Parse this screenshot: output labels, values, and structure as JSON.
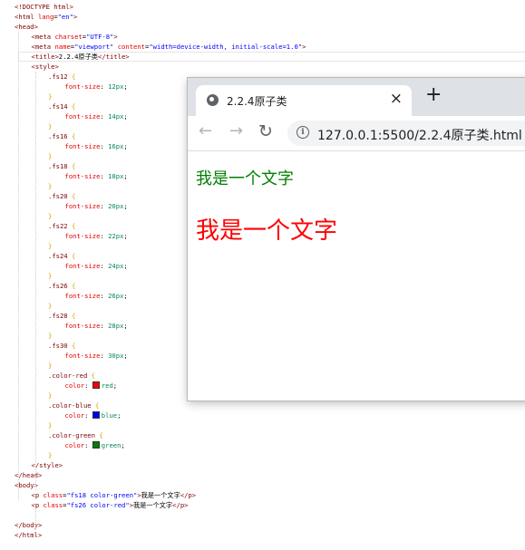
{
  "editor": {
    "lines": [
      {
        "indent": 0,
        "parts": [
          [
            "tag",
            "<!DOCTYPE html>"
          ]
        ]
      },
      {
        "indent": 0,
        "parts": [
          [
            "tag",
            "<html "
          ],
          [
            "attr",
            "lang"
          ],
          [
            "txt",
            "="
          ],
          [
            "str",
            "\"en\""
          ],
          [
            "tag",
            ">"
          ]
        ]
      },
      {
        "indent": 0,
        "parts": [
          [
            "tag",
            "<head>"
          ]
        ]
      },
      {
        "indent": 1,
        "parts": [
          [
            "tag",
            "<meta "
          ],
          [
            "attr",
            "charset"
          ],
          [
            "txt",
            "="
          ],
          [
            "str",
            "\"UTF-8\""
          ],
          [
            "tag",
            ">"
          ]
        ]
      },
      {
        "indent": 1,
        "parts": [
          [
            "tag",
            "<meta "
          ],
          [
            "attr",
            "name"
          ],
          [
            "txt",
            "="
          ],
          [
            "str",
            "\"viewport\""
          ],
          [
            "txt",
            " "
          ],
          [
            "attr",
            "content"
          ],
          [
            "txt",
            "="
          ],
          [
            "str",
            "\"width=device-width, initial-scale=1.0\""
          ],
          [
            "tag",
            ">"
          ]
        ]
      },
      {
        "indent": 1,
        "parts": [
          [
            "tag",
            "<title>"
          ],
          [
            "txt",
            "2.2.4原子类"
          ],
          [
            "tag",
            "</title>"
          ]
        ]
      },
      {
        "indent": 1,
        "parts": [
          [
            "tag",
            "<style>"
          ]
        ]
      },
      {
        "indent": 2,
        "parts": [
          [
            "sel",
            ".fs12 "
          ],
          [
            "brace",
            "{"
          ]
        ]
      },
      {
        "indent": 3,
        "parts": [
          [
            "prop",
            "font-size"
          ],
          [
            "txt",
            ": "
          ],
          [
            "val",
            "12px"
          ],
          [
            "txt",
            ";"
          ]
        ]
      },
      {
        "indent": 2,
        "parts": [
          [
            "brace",
            "}"
          ]
        ]
      },
      {
        "indent": 2,
        "parts": [
          [
            "sel",
            ".fs14 "
          ],
          [
            "brace",
            "{"
          ]
        ]
      },
      {
        "indent": 3,
        "parts": [
          [
            "prop",
            "font-size"
          ],
          [
            "txt",
            ": "
          ],
          [
            "val",
            "14px"
          ],
          [
            "txt",
            ";"
          ]
        ]
      },
      {
        "indent": 2,
        "parts": [
          [
            "brace",
            "}"
          ]
        ]
      },
      {
        "indent": 2,
        "parts": [
          [
            "sel",
            ".fs16 "
          ],
          [
            "brace",
            "{"
          ]
        ]
      },
      {
        "indent": 3,
        "parts": [
          [
            "prop",
            "font-size"
          ],
          [
            "txt",
            ": "
          ],
          [
            "val",
            "16px"
          ],
          [
            "txt",
            ";"
          ]
        ]
      },
      {
        "indent": 2,
        "parts": [
          [
            "brace",
            "}"
          ]
        ]
      },
      {
        "indent": 2,
        "parts": [
          [
            "sel",
            ".fs18 "
          ],
          [
            "brace",
            "{"
          ]
        ]
      },
      {
        "indent": 3,
        "parts": [
          [
            "prop",
            "font-size"
          ],
          [
            "txt",
            ": "
          ],
          [
            "val",
            "18px"
          ],
          [
            "txt",
            ";"
          ]
        ]
      },
      {
        "indent": 2,
        "parts": [
          [
            "brace",
            "}"
          ]
        ]
      },
      {
        "indent": 2,
        "parts": [
          [
            "sel",
            ".fs20 "
          ],
          [
            "brace",
            "{"
          ]
        ]
      },
      {
        "indent": 3,
        "parts": [
          [
            "prop",
            "font-size"
          ],
          [
            "txt",
            ": "
          ],
          [
            "val",
            "20px"
          ],
          [
            "txt",
            ";"
          ]
        ]
      },
      {
        "indent": 2,
        "parts": [
          [
            "brace",
            "}"
          ]
        ]
      },
      {
        "indent": 2,
        "parts": [
          [
            "sel",
            ".fs22 "
          ],
          [
            "brace",
            "{"
          ]
        ]
      },
      {
        "indent": 3,
        "parts": [
          [
            "prop",
            "font-size"
          ],
          [
            "txt",
            ": "
          ],
          [
            "val",
            "22px"
          ],
          [
            "txt",
            ";"
          ]
        ]
      },
      {
        "indent": 2,
        "parts": [
          [
            "brace",
            "}"
          ]
        ]
      },
      {
        "indent": 2,
        "parts": [
          [
            "sel",
            ".fs24 "
          ],
          [
            "brace",
            "{"
          ]
        ]
      },
      {
        "indent": 3,
        "parts": [
          [
            "prop",
            "font-size"
          ],
          [
            "txt",
            ": "
          ],
          [
            "val",
            "24px"
          ],
          [
            "txt",
            ";"
          ]
        ]
      },
      {
        "indent": 2,
        "parts": [
          [
            "brace",
            "}"
          ]
        ]
      },
      {
        "indent": 2,
        "parts": [
          [
            "sel",
            ".fs26 "
          ],
          [
            "brace",
            "{"
          ]
        ]
      },
      {
        "indent": 3,
        "parts": [
          [
            "prop",
            "font-size"
          ],
          [
            "txt",
            ": "
          ],
          [
            "val",
            "26px"
          ],
          [
            "txt",
            ";"
          ]
        ]
      },
      {
        "indent": 2,
        "parts": [
          [
            "brace",
            "}"
          ]
        ]
      },
      {
        "indent": 2,
        "parts": [
          [
            "sel",
            ".fs28 "
          ],
          [
            "brace",
            "{"
          ]
        ]
      },
      {
        "indent": 3,
        "parts": [
          [
            "prop",
            "font-size"
          ],
          [
            "txt",
            ": "
          ],
          [
            "val",
            "28px"
          ],
          [
            "txt",
            ";"
          ]
        ]
      },
      {
        "indent": 2,
        "parts": [
          [
            "brace",
            "}"
          ]
        ]
      },
      {
        "indent": 2,
        "parts": [
          [
            "sel",
            ".fs30 "
          ],
          [
            "brace",
            "{"
          ]
        ]
      },
      {
        "indent": 3,
        "parts": [
          [
            "prop",
            "font-size"
          ],
          [
            "txt",
            ": "
          ],
          [
            "val",
            "30px"
          ],
          [
            "txt",
            ";"
          ]
        ]
      },
      {
        "indent": 2,
        "parts": [
          [
            "brace",
            "}"
          ]
        ]
      },
      {
        "indent": 2,
        "parts": [
          [
            "sel",
            ".color-red "
          ],
          [
            "brace",
            "{"
          ]
        ]
      },
      {
        "indent": 3,
        "parts": [
          [
            "prop",
            "color"
          ],
          [
            "txt",
            ": "
          ],
          [
            "swatch",
            "#ff0000"
          ],
          [
            "val",
            "red"
          ],
          [
            "txt",
            ";"
          ]
        ]
      },
      {
        "indent": 2,
        "parts": [
          [
            "brace",
            "}"
          ]
        ]
      },
      {
        "indent": 2,
        "parts": [
          [
            "sel",
            ".color-blue "
          ],
          [
            "brace",
            "{"
          ]
        ]
      },
      {
        "indent": 3,
        "parts": [
          [
            "prop",
            "color"
          ],
          [
            "txt",
            ": "
          ],
          [
            "swatch",
            "#0000ff"
          ],
          [
            "val",
            "blue"
          ],
          [
            "txt",
            ";"
          ]
        ]
      },
      {
        "indent": 2,
        "parts": [
          [
            "brace",
            "}"
          ]
        ]
      },
      {
        "indent": 2,
        "parts": [
          [
            "sel",
            ".color-green "
          ],
          [
            "brace",
            "{"
          ]
        ]
      },
      {
        "indent": 3,
        "parts": [
          [
            "prop",
            "color"
          ],
          [
            "txt",
            ": "
          ],
          [
            "swatch",
            "#008000"
          ],
          [
            "val",
            "green"
          ],
          [
            "txt",
            ";"
          ]
        ]
      },
      {
        "indent": 2,
        "parts": [
          [
            "brace",
            "}"
          ]
        ]
      },
      {
        "indent": 1,
        "parts": [
          [
            "tag",
            "</style>"
          ]
        ]
      },
      {
        "indent": 0,
        "parts": [
          [
            "tag",
            "</head>"
          ]
        ]
      },
      {
        "indent": 0,
        "parts": [
          [
            "tag",
            "<body>"
          ]
        ]
      },
      {
        "indent": 1,
        "parts": [
          [
            "tag",
            "<p "
          ],
          [
            "attr",
            "class"
          ],
          [
            "txt",
            "="
          ],
          [
            "str",
            "\"fs18 color-green\""
          ],
          [
            "tag",
            ">"
          ],
          [
            "txt",
            "我是一个文字"
          ],
          [
            "tag",
            "</p>"
          ]
        ]
      },
      {
        "indent": 1,
        "parts": [
          [
            "tag",
            "<p "
          ],
          [
            "attr",
            "class"
          ],
          [
            "txt",
            "="
          ],
          [
            "str",
            "\"fs26 color-red\""
          ],
          [
            "tag",
            ">"
          ],
          [
            "txt",
            "我是一个文字"
          ],
          [
            "tag",
            "</p>"
          ]
        ]
      },
      {
        "indent": 0,
        "parts": [
          [
            "txt",
            ""
          ]
        ]
      },
      {
        "indent": 0,
        "parts": [
          [
            "tag",
            "</body>"
          ]
        ]
      },
      {
        "indent": 0,
        "parts": [
          [
            "tag",
            "</html>"
          ]
        ]
      }
    ]
  },
  "browser": {
    "tab_title": "2.2.4原子类",
    "tab_close": "×",
    "new_tab": "+",
    "back_icon": "←",
    "forward_icon": "→",
    "reload_icon": "↻",
    "info_icon": "i",
    "url_host": "127.0.0.1",
    "url_rest": ":5500/2.2.4原子类.html"
  },
  "page": {
    "p1_text": "我是一个文字",
    "p2_text": "我是一个文字"
  },
  "colors": {
    "green": "#008000",
    "red": "#ff0000"
  }
}
